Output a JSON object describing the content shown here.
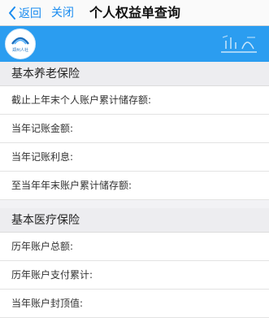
{
  "nav": {
    "back_label": "返回",
    "close_label": "关闭",
    "title": "个人权益单查询"
  },
  "banner": {
    "logo_text": "郑州人社",
    "accent_color": "#2b9df0"
  },
  "sections": [
    {
      "title": "基本养老保险",
      "rows": [
        {
          "label": "截止上年末个人账户累计储存额:",
          "value": ""
        },
        {
          "label": "当年记账金额:",
          "value": ""
        },
        {
          "label": "当年记账利息:",
          "value": ""
        },
        {
          "label": "至当年年末账户累计储存额:",
          "value": ""
        }
      ]
    },
    {
      "title": "基本医疗保险",
      "rows": [
        {
          "label": "历年账户总额:",
          "value": ""
        },
        {
          "label": "历年账户支付累计:",
          "value": ""
        },
        {
          "label": "当年账户封顶值:",
          "value": ""
        }
      ]
    }
  ]
}
